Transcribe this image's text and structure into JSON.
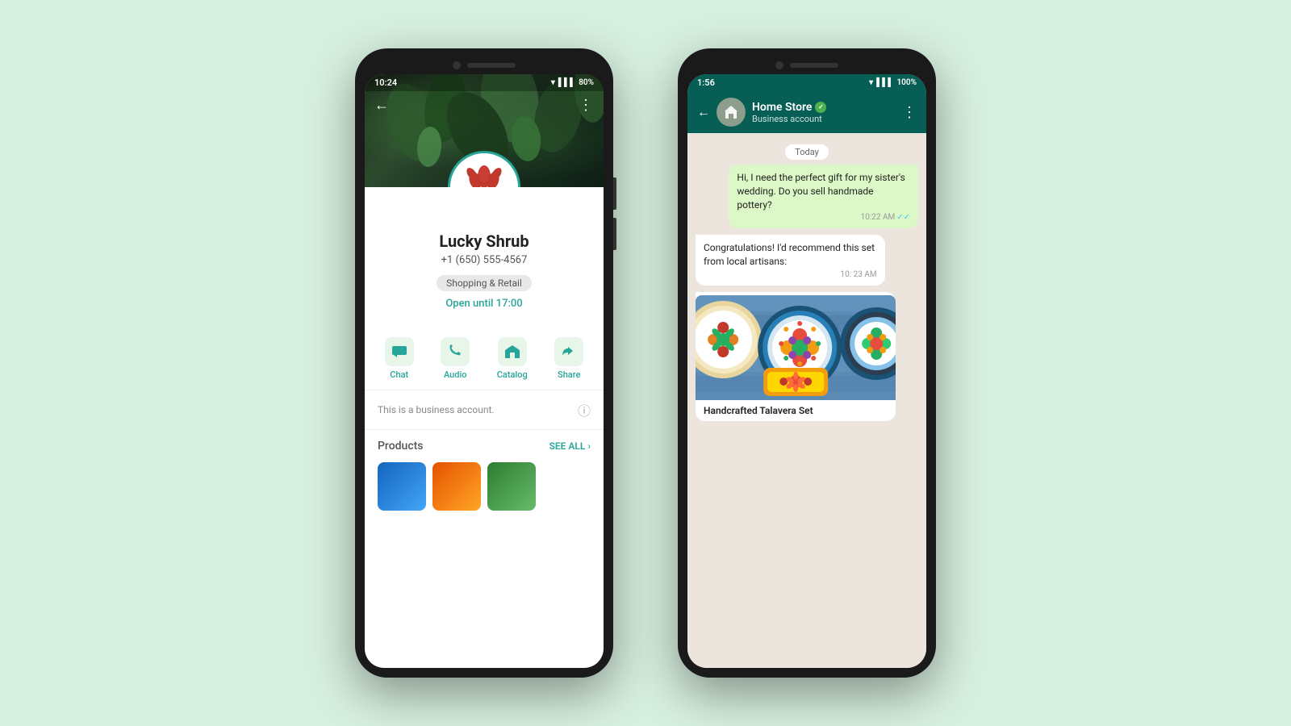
{
  "background_color": "#d8f0e0",
  "phone1": {
    "status_bar": {
      "time": "10:24",
      "battery": "80%",
      "color": "#fff"
    },
    "header": {
      "back_label": "←",
      "menu_label": "⋮"
    },
    "profile": {
      "name": "Lucky Shrub",
      "phone": "+1 (650) 555-4567",
      "category": "Shopping & Retail",
      "hours": "Open until 17:00"
    },
    "actions": [
      {
        "id": "chat",
        "icon": "💬",
        "label": "Chat"
      },
      {
        "id": "audio",
        "icon": "📞",
        "label": "Audio"
      },
      {
        "id": "catalog",
        "icon": "🏪",
        "label": "Catalog"
      },
      {
        "id": "share",
        "icon": "↪",
        "label": "Share"
      }
    ],
    "business_note": "This is a business account.",
    "products_label": "Products",
    "see_all_label": "SEE ALL ›"
  },
  "phone2": {
    "status_bar": {
      "time": "1:56",
      "battery": "100%",
      "color": "#fff"
    },
    "header": {
      "back_label": "←",
      "business_name": "Home Store",
      "verified_label": "✓",
      "subtitle": "Business account",
      "menu_label": "⋮"
    },
    "chat": {
      "date_label": "Today",
      "messages": [
        {
          "id": "msg1",
          "type": "sent",
          "text": "Hi, I need the perfect gift for my sister's wedding. Do you sell handmade pottery?",
          "time": "10:22 AM",
          "read": true
        },
        {
          "id": "msg2",
          "type": "received",
          "text": "Congratulations! I'd recommend this set from local artisans:",
          "time": "10: 23 AM"
        }
      ],
      "product_card": {
        "title": "Handcrafted Talavera Set"
      }
    }
  }
}
